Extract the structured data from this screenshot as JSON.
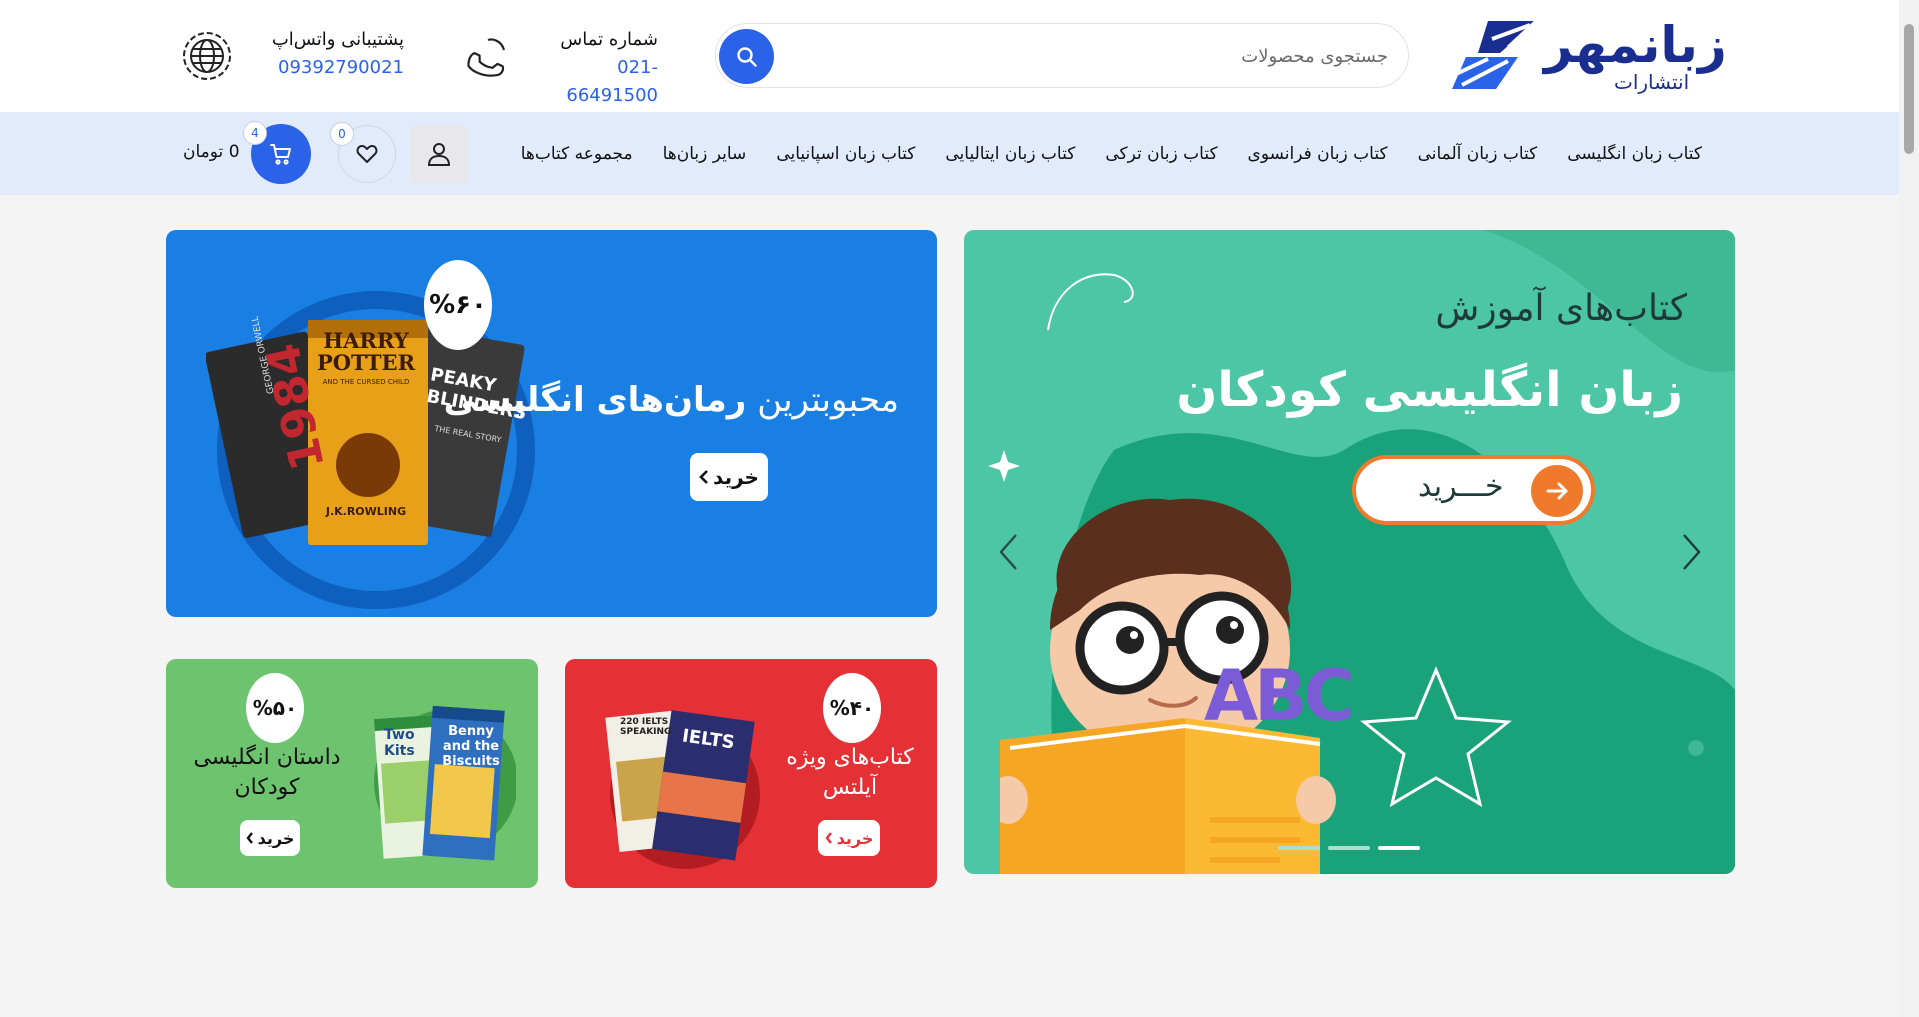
{
  "header": {
    "logo": {
      "name": "زبانمهر",
      "sub": "انتشارات"
    },
    "search": {
      "placeholder": "جستجوی محصولات"
    },
    "phone": {
      "label": "شماره تماس",
      "value": "021-66491500"
    },
    "whatsapp": {
      "label": "پشتیبانی واتس‌اپ",
      "value": "09392790021"
    }
  },
  "nav": {
    "items": [
      {
        "label": "کتاب زبان انگلیسی"
      },
      {
        "label": "کتاب زبان آلمانی"
      },
      {
        "label": "کتاب زبان فرانسوی"
      },
      {
        "label": "کتاب زبان ترکی"
      },
      {
        "label": "کتاب زبان ایتالیایی"
      },
      {
        "label": "کتاب زبان اسپانیایی"
      },
      {
        "label": "سایر زبان‌ها"
      },
      {
        "label": "مجموعه کتاب‌ها"
      }
    ],
    "wishlist_count": "0",
    "cart_count": "4",
    "cart_total": "0 تومان"
  },
  "hero": {
    "title_line1": "کتاب‌های آموزش",
    "title_line2": "زبان انگلیسی کودکان",
    "buy_label": "خـــرید",
    "book_letters": "ABC",
    "slides": 3,
    "active_slide": 1
  },
  "promo_blue": {
    "discount": "%۶۰",
    "title_light": "محبوبترین",
    "title_bold": "رمان‌های انگلیسی",
    "buy_label": "خرید",
    "book_titles": {
      "harry": "HARRY POTTER",
      "harry_sub": "AND THE CURSED CHILD",
      "author": "J.K.ROWLING",
      "peaky": "PEAKY BLINDERS",
      "peaky_sub": "THE REAL STORY",
      "orwell": "1984",
      "orwell_author": "GEORGE ORWELL"
    }
  },
  "promo_red": {
    "discount": "%۴۰",
    "title": "کتاب‌های ویژه آیلتس",
    "buy_label": "خرید",
    "book_titles": {
      "ielts": "IELTS",
      "ielts220": "220 IELTS SPEAKING"
    }
  },
  "promo_green": {
    "discount": "%۵۰",
    "title": "داستان انگلیسی کودکان",
    "buy_label": "خرید",
    "book_titles": {
      "b1": "Two Kits",
      "b2": "Benny and the Biscuits"
    }
  },
  "colors": {
    "accent": "#2a62e8",
    "navbar_bg": "#e2ebfb",
    "hero_bg": "#4cc6a4",
    "blue_bg": "#1a7fe3",
    "red_bg": "#e53036",
    "green_bg": "#6ec46e",
    "orange": "#f07a2b"
  }
}
